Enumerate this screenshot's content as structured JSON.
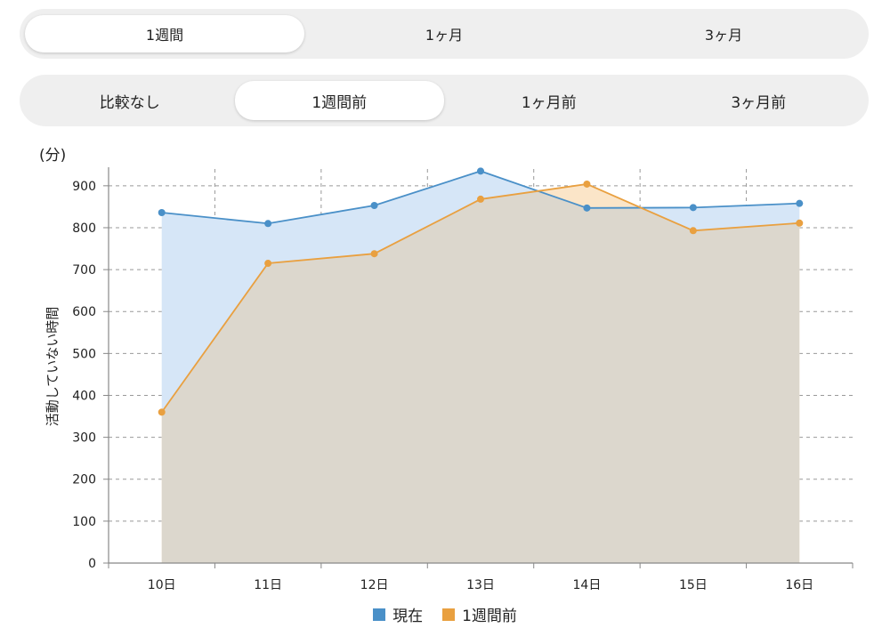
{
  "period_tabs": [
    {
      "label": "1週間",
      "active": true
    },
    {
      "label": "1ヶ月",
      "active": false
    },
    {
      "label": "3ヶ月",
      "active": false
    }
  ],
  "compare_tabs": [
    {
      "label": "比較なし",
      "active": false
    },
    {
      "label": "1週間前",
      "active": true
    },
    {
      "label": "1ヶ月前",
      "active": false
    },
    {
      "label": "3ヶ月前",
      "active": false
    }
  ],
  "colors": {
    "current_line": "#4a90c8",
    "current_fill": "#d6e6f7",
    "previous_line": "#e9a040",
    "previous_fill": "#fbe5c8",
    "overlap_fill": "#dcd7cd"
  },
  "chart_data": {
    "type": "area",
    "unit_label": "(分)",
    "ylabel": "活動していない時間",
    "xlabel": "",
    "categories": [
      "10日",
      "11日",
      "12日",
      "13日",
      "14日",
      "15日",
      "16日"
    ],
    "ylim": [
      0,
      940
    ],
    "yticks": [
      0,
      100,
      200,
      300,
      400,
      500,
      600,
      700,
      800,
      900
    ],
    "grid": true,
    "legend_position": "bottom",
    "series": [
      {
        "name": "現在",
        "values": [
          836,
          810,
          853,
          935,
          847,
          848,
          858
        ]
      },
      {
        "name": "1週間前",
        "values": [
          360,
          715,
          738,
          868,
          904,
          793,
          811
        ]
      }
    ]
  }
}
